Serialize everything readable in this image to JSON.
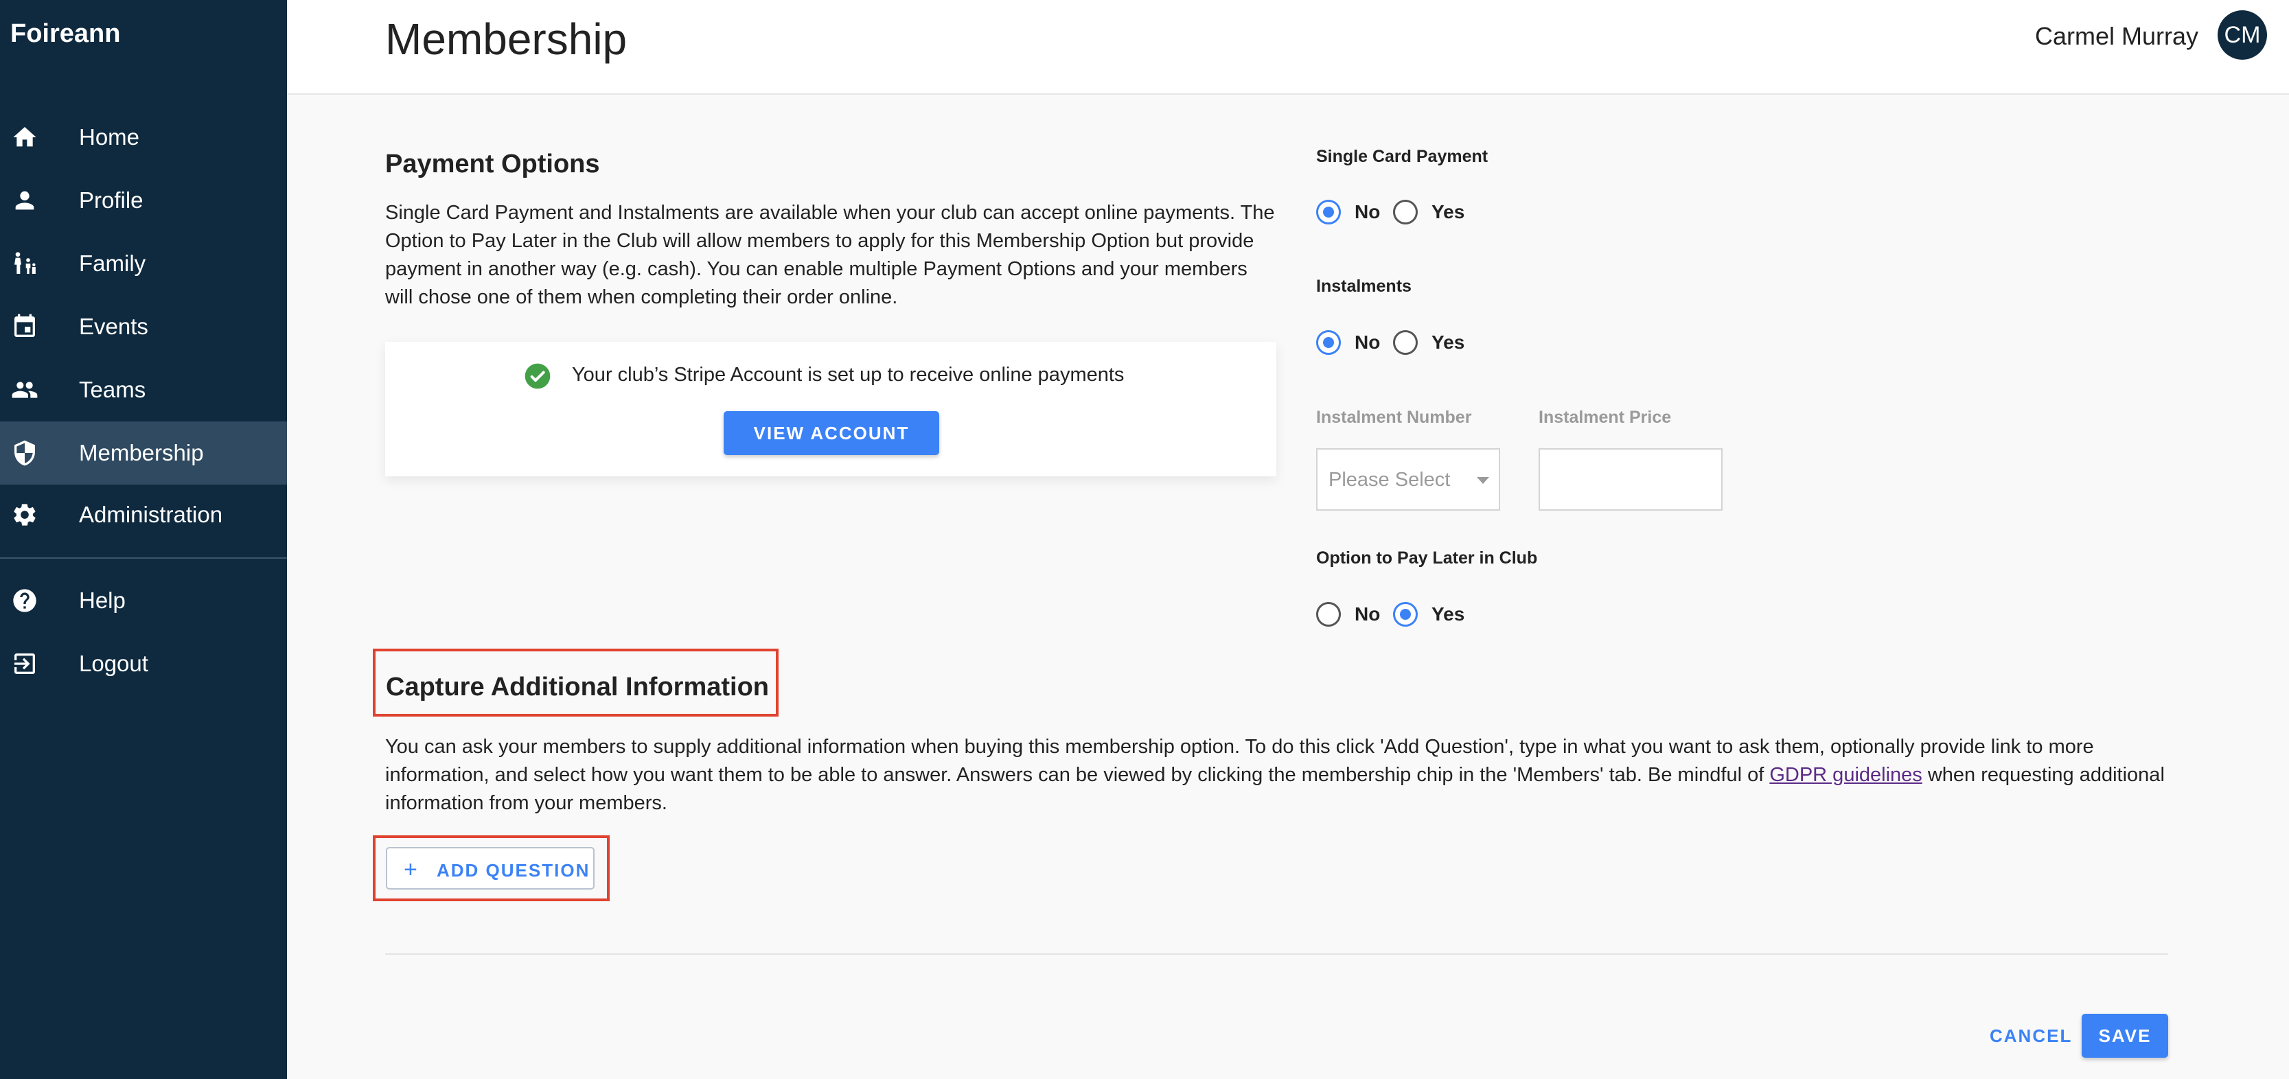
{
  "sidebar": {
    "brand": "Foireann",
    "items": [
      {
        "label": "Home",
        "icon": "home-icon"
      },
      {
        "label": "Profile",
        "icon": "person-icon"
      },
      {
        "label": "Family",
        "icon": "family-icon"
      },
      {
        "label": "Events",
        "icon": "calendar-icon"
      },
      {
        "label": "Teams",
        "icon": "group-icon"
      },
      {
        "label": "Membership",
        "icon": "shield-icon",
        "active": true
      },
      {
        "label": "Administration",
        "icon": "gear-icon"
      },
      {
        "label": "Help",
        "icon": "help-icon"
      },
      {
        "label": "Logout",
        "icon": "logout-icon"
      }
    ]
  },
  "header": {
    "title": "Membership",
    "user_name": "Carmel Murray",
    "avatar_initials": "CM"
  },
  "payment_options": {
    "title": "Payment Options",
    "description": "Single Card Payment and Instalments are available when your club can accept online payments. The Option to Pay Later in the Club will allow members to apply for this Membership Option but provide payment in another way (e.g. cash). You can enable multiple Payment Options and your members will chose one of them when completing their order online.",
    "stripe_message": "Your club’s Stripe Account is set up to receive online payments",
    "view_account_label": "VIEW ACCOUNT"
  },
  "form": {
    "single_card_payment": {
      "label": "Single Card Payment",
      "options": [
        "No",
        "Yes"
      ],
      "selected": "No"
    },
    "instalments": {
      "label": "Instalments",
      "options": [
        "No",
        "Yes"
      ],
      "selected": "No"
    },
    "instalment_number": {
      "label": "Instalment Number",
      "placeholder": "Please Select"
    },
    "instalment_price": {
      "label": "Instalment Price",
      "value": ""
    },
    "pay_later": {
      "label": "Option to Pay Later in Club",
      "options": [
        "No",
        "Yes"
      ],
      "selected": "Yes"
    }
  },
  "capture": {
    "title": "Capture Additional Information",
    "description_before": "You can ask your members to supply additional information when buying this membership option. To do this click 'Add Question', type in what you want to ask them, optionally provide link to more information, and select how you want them to be able to answer. Answers can be viewed by clicking the membership chip in the 'Members' tab. Be mindful of ",
    "link_text": "GDPR guidelines",
    "description_after": " when requesting additional information from your members.",
    "add_question_label": "ADD QUESTION",
    "add_question_icon": "plus-icon"
  },
  "footer": {
    "cancel_label": "CANCEL",
    "save_label": "SAVE"
  },
  "colors": {
    "sidebar": "#0f2a3f",
    "accent": "#3b82f6",
    "highlight": "#e0432f",
    "success": "#43a047"
  }
}
